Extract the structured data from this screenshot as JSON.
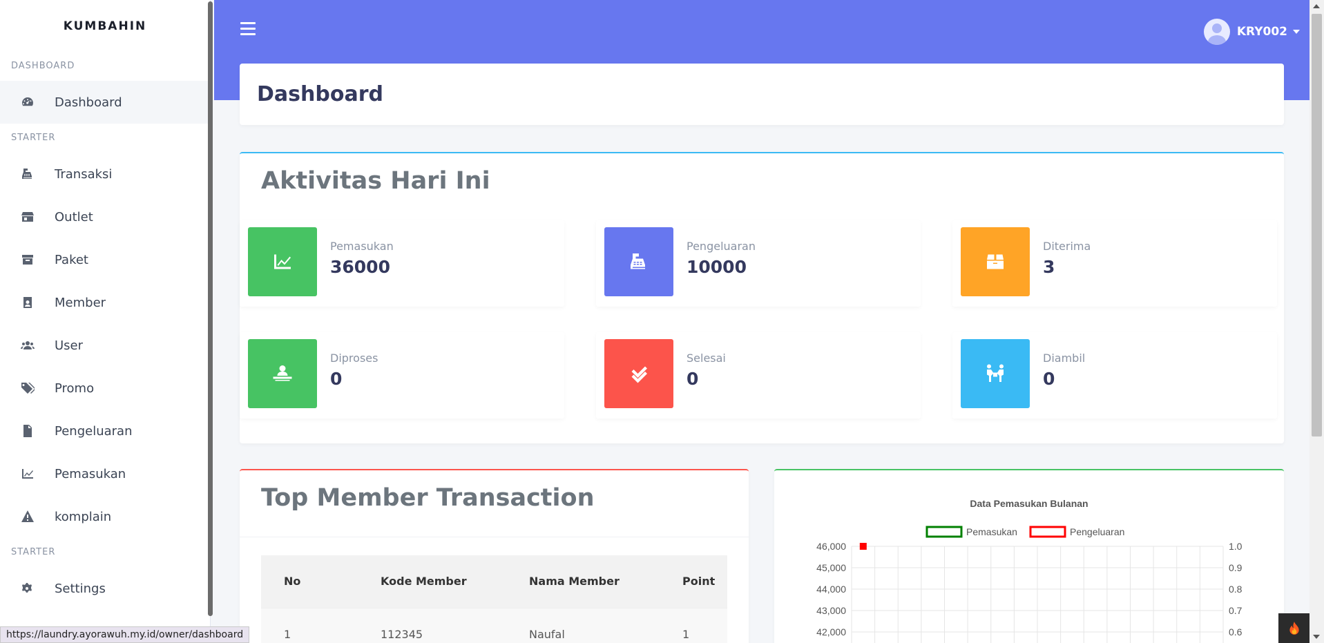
{
  "sidebar": {
    "brand": "KUMBAHIN",
    "sections": [
      {
        "label": "DASHBOARD",
        "items": [
          {
            "label": "Dashboard",
            "icon": "gauge-icon",
            "active": true
          }
        ]
      },
      {
        "label": "STARTER",
        "items": [
          {
            "label": "Transaksi",
            "icon": "cash-register-icon"
          },
          {
            "label": "Outlet",
            "icon": "store-icon"
          },
          {
            "label": "Paket",
            "icon": "archive-icon"
          },
          {
            "label": "Member",
            "icon": "id-badge-icon"
          },
          {
            "label": "User",
            "icon": "users-icon"
          },
          {
            "label": "Promo",
            "icon": "tags-icon"
          },
          {
            "label": "Pengeluaran",
            "icon": "file-invoice-icon"
          },
          {
            "label": "Pemasukan",
            "icon": "chart-line-icon"
          },
          {
            "label": "komplain",
            "icon": "warning-icon"
          }
        ]
      },
      {
        "label": "STARTER",
        "items": [
          {
            "label": "Settings",
            "icon": "cogs-icon"
          }
        ]
      }
    ]
  },
  "topbar": {
    "username": "KRY002"
  },
  "page": {
    "title": "Dashboard"
  },
  "activity": {
    "title": "Aktivitas Hari Ini",
    "stats": [
      {
        "label": "Pemasukan",
        "value": "36000",
        "color": "#47c363",
        "icon": "chart-line-icon"
      },
      {
        "label": "Pengeluaran",
        "value": "10000",
        "color": "#6777ef",
        "icon": "cash-register-icon"
      },
      {
        "label": "Diterima",
        "value": "3",
        "color": "#ffa426",
        "icon": "box-icon"
      },
      {
        "label": "Diproses",
        "value": "0",
        "color": "#47c363",
        "icon": "person-desk-icon"
      },
      {
        "label": "Selesai",
        "value": "0",
        "color": "#fc544b",
        "icon": "double-check-icon"
      },
      {
        "label": "Diambil",
        "value": "0",
        "color": "#3abaf4",
        "icon": "people-carry-icon"
      }
    ]
  },
  "members": {
    "title": "Top Member Transaction",
    "columns": [
      "No",
      "Kode Member",
      "Nama Member",
      "Point"
    ],
    "rows": [
      [
        "1",
        "112345",
        "Naufal",
        "1"
      ]
    ]
  },
  "chart_data": {
    "type": "line",
    "title": "Data Pemasukan Bulanan",
    "series": [
      {
        "name": "Pemasukan",
        "color": "#008000",
        "points": [
          {
            "x": 1,
            "y": 46000
          }
        ]
      },
      {
        "name": "Pengeluaran",
        "color": "#ff0000",
        "points": []
      }
    ],
    "y_left": {
      "ticks": [
        "46,000",
        "45,000",
        "44,000",
        "43,000",
        "42,000"
      ],
      "values": [
        46000,
        45000,
        44000,
        43000,
        42000
      ]
    },
    "y_right": {
      "ticks": [
        "1.0",
        "0.9",
        "0.8",
        "0.7",
        "0.6"
      ]
    },
    "grid": true,
    "legend": "top"
  },
  "statusbar": {
    "url": "https://laundry.ayorawuh.my.id/owner/dashboard"
  }
}
